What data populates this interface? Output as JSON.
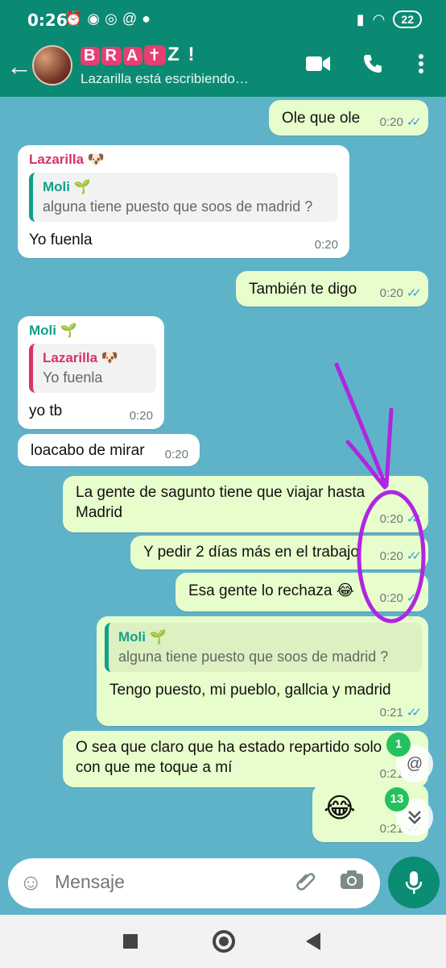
{
  "status": {
    "time": "0:26",
    "battery": "22"
  },
  "header": {
    "group_title": "RA Z !",
    "group_title_tiles": [
      "B",
      "R",
      "A",
      "✝",
      "Z"
    ],
    "subtitle": "Lazarilla está escribiendo…"
  },
  "messages": [
    {
      "dir": "out",
      "text": "Ole que ole",
      "time": "0:20",
      "read": true
    },
    {
      "dir": "in",
      "sender": "Lazarilla 🐶",
      "quote_name": "Moli 🌱",
      "quote_text": "alguna tiene puesto que soos de madrid ?",
      "text": "Yo fuenla",
      "time": "0:20"
    },
    {
      "dir": "out",
      "text": "También te digo",
      "time": "0:20",
      "read": true
    },
    {
      "dir": "in",
      "sender": "Moli 🌱",
      "quote_name": "Lazarilla 🐶",
      "quote_text": "Yo fuenla",
      "text": "yo tb",
      "time": "0:20"
    },
    {
      "dir": "in",
      "text": "loacabo de mirar",
      "time": "0:20"
    },
    {
      "dir": "out",
      "text": "La gente de sagunto tiene que viajar hasta Madrid",
      "time": "0:20",
      "read": true
    },
    {
      "dir": "out",
      "text": "Y pedir 2 días más en el trabajo",
      "time": "0:20",
      "read": true
    },
    {
      "dir": "out",
      "text": "Esa gente lo rechaza 😂",
      "time": "0:20",
      "read": true
    },
    {
      "dir": "out",
      "quote_name": "Moli 🌱",
      "quote_text": "alguna tiene puesto que soos de madrid ?",
      "text": "Tengo puesto, mi pueblo, gallcia y madrid",
      "time": "0:21",
      "read": true
    },
    {
      "dir": "out",
      "text": "O sea que claro que ha estado repartido solo con que me toque a mí",
      "time": "0:21",
      "read": true
    },
    {
      "dir": "out",
      "text": "😂",
      "time": "0:21",
      "read": true
    }
  ],
  "badges": {
    "mentions": "1",
    "unread": "13"
  },
  "composer": {
    "placeholder": "Mensaje"
  },
  "colors": {
    "header": "#0b8a73",
    "outgoing_bubble": "#e8fdcc",
    "chat_bg": "#5fb3c9",
    "annotation": "#b026e0"
  }
}
